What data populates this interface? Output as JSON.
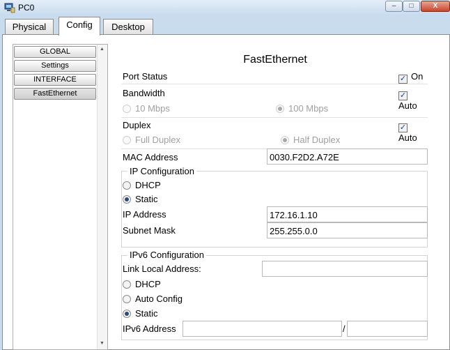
{
  "window": {
    "title": "PC0",
    "minimize_glyph": "–",
    "maximize_glyph": "□",
    "close_glyph": "X"
  },
  "tabs": [
    {
      "label": "Physical"
    },
    {
      "label": "Config",
      "active": true
    },
    {
      "label": "Desktop"
    }
  ],
  "sidebar": {
    "items": [
      {
        "label": "GLOBAL"
      },
      {
        "label": "Settings"
      },
      {
        "label": "INTERFACE"
      },
      {
        "label": "FastEthernet",
        "selected": true
      }
    ]
  },
  "panel": {
    "heading": "FastEthernet",
    "port_status": {
      "label": "Port Status",
      "checkbox_label": "On",
      "checked": true
    },
    "bandwidth": {
      "label": "Bandwidth",
      "auto_label": "Auto",
      "auto_checked": true,
      "options": [
        "10 Mbps",
        "100 Mbps"
      ],
      "selected": "100 Mbps"
    },
    "duplex": {
      "label": "Duplex",
      "auto_label": "Auto",
      "auto_checked": true,
      "options": [
        "Full Duplex",
        "Half Duplex"
      ],
      "selected": "Half Duplex"
    },
    "mac_address": {
      "label": "MAC Address",
      "value": "0030.F2D2.A72E"
    },
    "ip_config": {
      "legend": "IP Configuration",
      "options": [
        "DHCP",
        "Static"
      ],
      "selected": "Static",
      "ip_address": {
        "label": "IP Address",
        "value": "172.16.1.10"
      },
      "subnet_mask": {
        "label": "Subnet Mask",
        "value": "255.255.0.0"
      }
    },
    "ipv6_config": {
      "legend": "IPv6 Configuration",
      "link_local": {
        "label": "Link Local Address:",
        "value": ""
      },
      "options": [
        "DHCP",
        "Auto Config",
        "Static"
      ],
      "selected": "Static",
      "ipv6_address": {
        "label": "IPv6 Address",
        "value": "",
        "prefix_separator": "/",
        "prefix": ""
      }
    }
  },
  "icons": {
    "app": "pc-icon",
    "check": "✓"
  },
  "colors": {
    "titlebar": "#c8dbee",
    "close_button": "#c9462c",
    "radio_dot": "#2a4a78"
  }
}
